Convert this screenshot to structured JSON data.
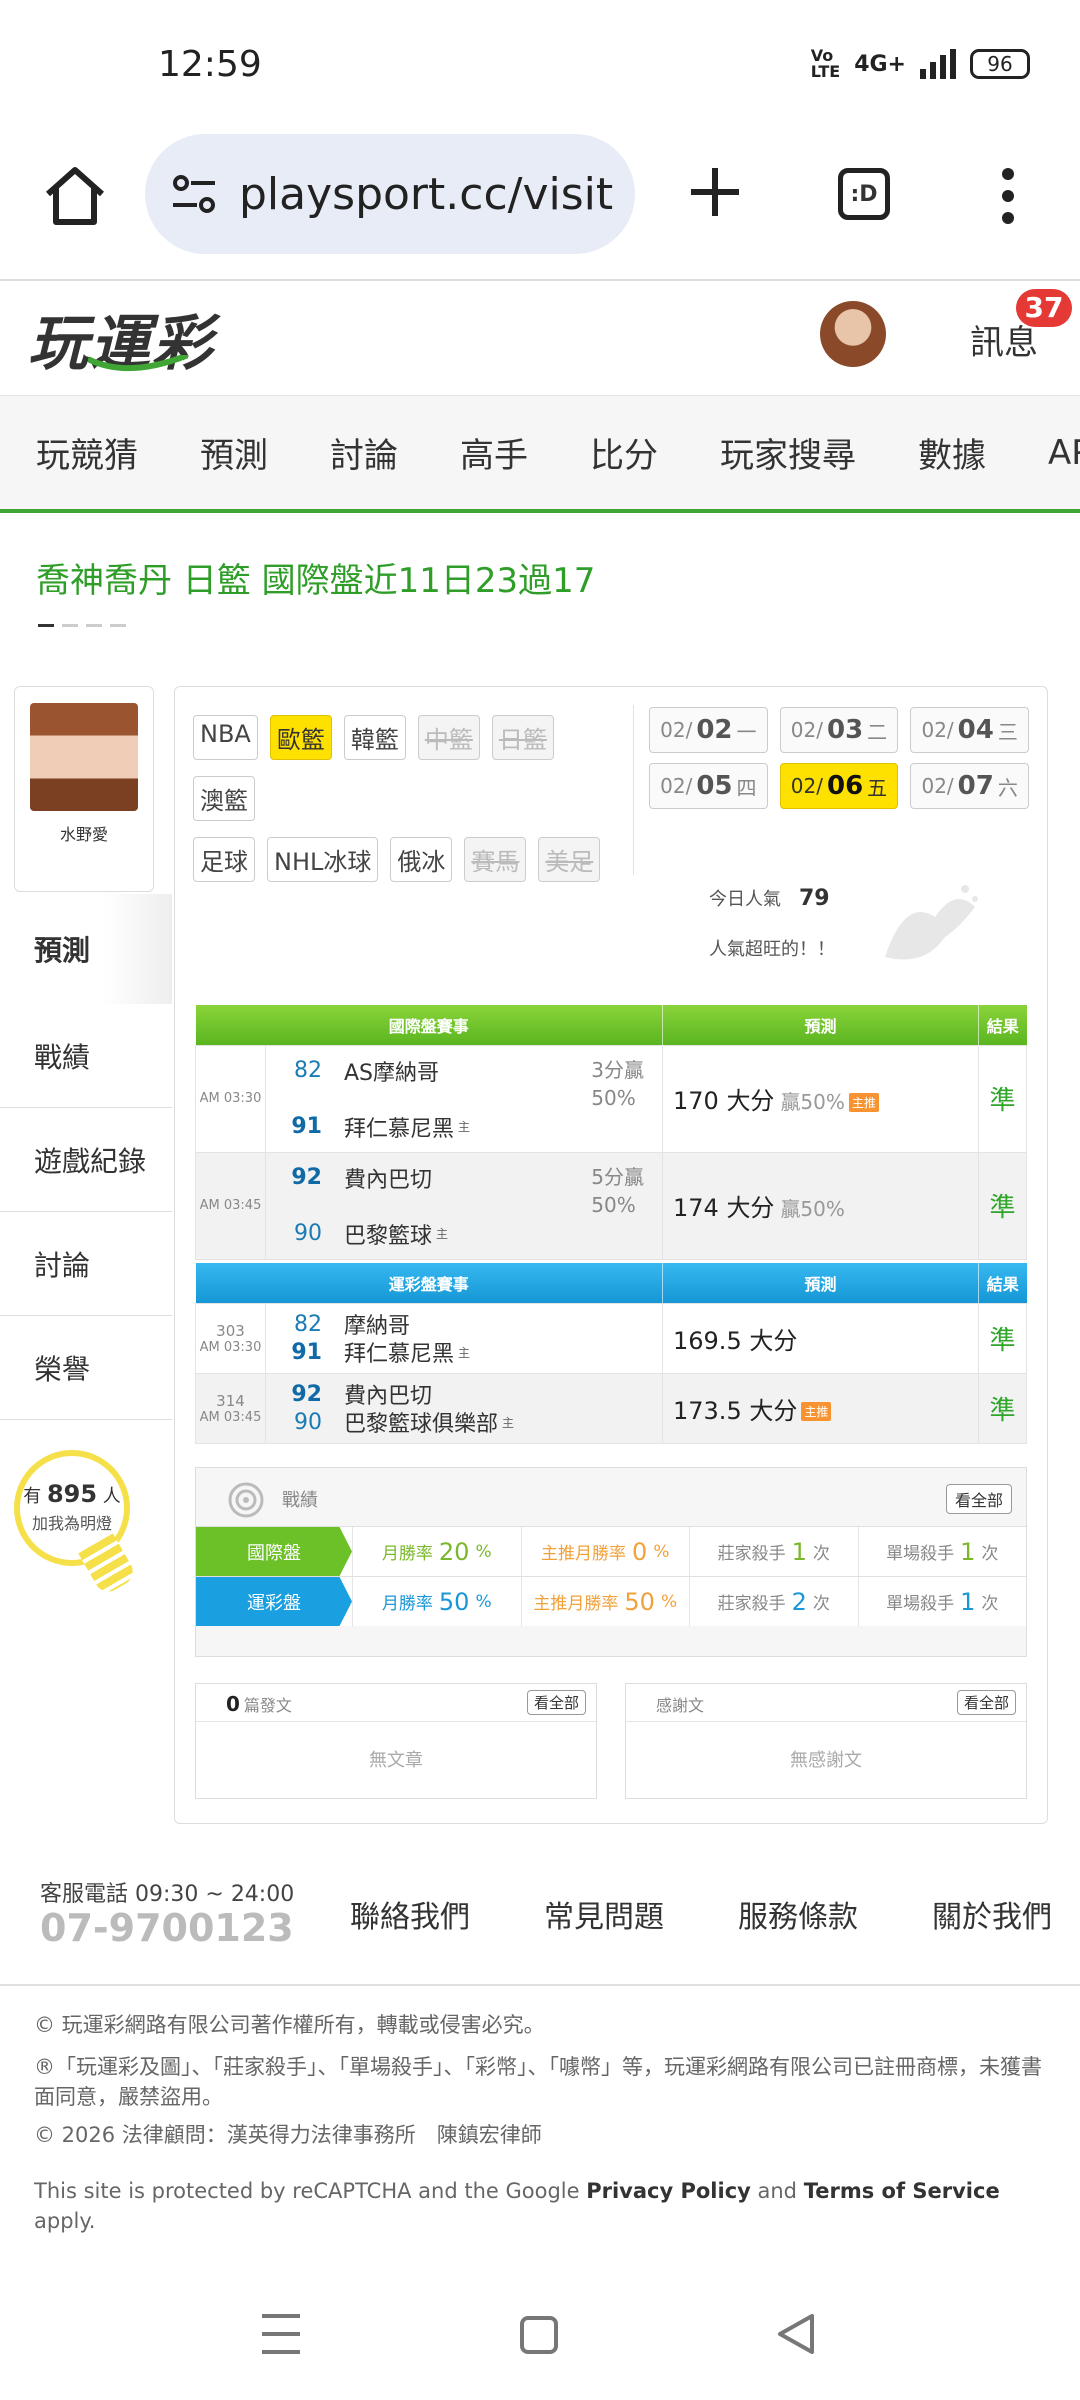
{
  "status": {
    "time": "12:59",
    "network": "4G+",
    "battery": "96"
  },
  "browser": {
    "url": "playsport.cc/visit",
    "tab_label": ":D"
  },
  "site": {
    "logo": "玩運彩",
    "messages_label": "訊息",
    "messages_count": "37"
  },
  "nav": [
    "玩競猜",
    "預測",
    "討論",
    "高手",
    "比分",
    "玩家搜尋",
    "數據",
    "APP"
  ],
  "headline": "喬神喬丹 日籃 國際盤近11日23過17",
  "user": {
    "name": "水野愛"
  },
  "sidebar": [
    "預測",
    "戰績",
    "遊戲紀錄",
    "討論",
    "榮譽"
  ],
  "fans": {
    "prefix": "有",
    "count": "895",
    "suffix": "人",
    "cta": "加我為明燈"
  },
  "sports": {
    "row1": [
      {
        "label": "NBA",
        "state": ""
      },
      {
        "label": "歐籃",
        "state": "sel"
      },
      {
        "label": "韓籃",
        "state": ""
      },
      {
        "label": "中籃",
        "state": "dis"
      },
      {
        "label": "日籃",
        "state": "dis"
      }
    ],
    "row2": [
      {
        "label": "澳籃",
        "state": ""
      }
    ],
    "row3": [
      {
        "label": "足球",
        "state": ""
      },
      {
        "label": "NHL冰球",
        "state": ""
      },
      {
        "label": "俄冰",
        "state": ""
      },
      {
        "label": "賽馬",
        "state": "dis"
      },
      {
        "label": "美足",
        "state": "dis"
      }
    ]
  },
  "dates": [
    {
      "m": "02/",
      "d": "02",
      "w": "一",
      "sel": false
    },
    {
      "m": "02/",
      "d": "03",
      "w": "二",
      "sel": false
    },
    {
      "m": "02/",
      "d": "04",
      "w": "三",
      "sel": false
    },
    {
      "m": "02/",
      "d": "05",
      "w": "四",
      "sel": false
    },
    {
      "m": "02/",
      "d": "06",
      "w": "五",
      "sel": true
    },
    {
      "m": "02/",
      "d": "07",
      "w": "六",
      "sel": false
    }
  ],
  "popularity": {
    "label": "今日人氣",
    "value": "79",
    "note": "人氣超旺的！！"
  },
  "intl": {
    "headers": [
      "國際盤賽事",
      "預測",
      "結果"
    ],
    "games": [
      {
        "time": "AM 03:30",
        "away": {
          "score": "82",
          "name": "AS摩納哥"
        },
        "home": {
          "score": "91",
          "name": "拜仁慕尼黑"
        },
        "odds1": "3分贏",
        "odds2": "50%",
        "pred": "170 大分",
        "pred_note": "贏50%",
        "zhu": "主推",
        "result": "準"
      },
      {
        "time": "AM 03:45",
        "away": {
          "score": "92",
          "name": "費內巴切"
        },
        "home": {
          "score": "90",
          "name": "巴黎籃球"
        },
        "odds1": "5分贏",
        "odds2": "50%",
        "pred": "174 大分",
        "pred_note": "贏50%",
        "zhu": "",
        "result": "準"
      }
    ],
    "home_mark": "主"
  },
  "lottery": {
    "headers": [
      "運彩盤賽事",
      "預測",
      "結果"
    ],
    "games": [
      {
        "no": "303",
        "time": "AM 03:30",
        "away": {
          "score": "82",
          "name": "摩納哥"
        },
        "home": {
          "score": "91",
          "name": "拜仁慕尼黑"
        },
        "pred": "169.5 大分",
        "zhu": "",
        "result": "準"
      },
      {
        "no": "314",
        "time": "AM 03:45",
        "away": {
          "score": "92",
          "name": "費內巴切"
        },
        "home": {
          "score": "90",
          "name": "巴黎籃球俱樂部"
        },
        "pred": "173.5 大分",
        "zhu": "主推",
        "result": "準"
      }
    ]
  },
  "record": {
    "title": "戰績",
    "all_label": "看全部",
    "rows": [
      {
        "tag": "國際盤",
        "monthly_label": "月勝率",
        "monthly": "20",
        "main_label": "主推月勝率",
        "main": "0",
        "banker_label": "莊家殺手",
        "banker": "1",
        "single_label": "單場殺手",
        "single": "1",
        "unit": "次",
        "pct": "%"
      },
      {
        "tag": "運彩盤",
        "monthly_label": "月勝率",
        "monthly": "50",
        "main_label": "主推月勝率",
        "main": "50",
        "banker_label": "莊家殺手",
        "banker": "2",
        "single_label": "單場殺手",
        "single": "1",
        "unit": "次",
        "pct": "%"
      }
    ]
  },
  "articles": {
    "count": "0",
    "label": "篇發文",
    "all_label": "看全部",
    "empty": "無文章"
  },
  "thanks": {
    "label": "感謝文",
    "all_label": "看全部",
    "empty": "無感謝文"
  },
  "footer": {
    "service": "客服電話 09:30 ~ 24:00",
    "tel": "07-9700123",
    "links": [
      "聯絡我們",
      "常見問題",
      "服務條款",
      "關於我們"
    ],
    "copyright": "© 玩運彩網路有限公司著作權所有，轉載或侵害必究。",
    "trademark": "®「玩運彩及圖」、「莊家殺手」、「單場殺手」、「彩幣」、「噱幣」等，玩運彩網路有限公司已註冊商標，未獲書面同意，嚴禁盜用。",
    "legal": "© 2026 法律顧問：漢英得力法律事務所　陳鎮宏律師",
    "recaptcha_pre": "This site is protected by reCAPTCHA and the Google ",
    "privacy": "Privacy Policy",
    "and": " and ",
    "terms": "Terms of Service",
    "apply": " apply."
  }
}
